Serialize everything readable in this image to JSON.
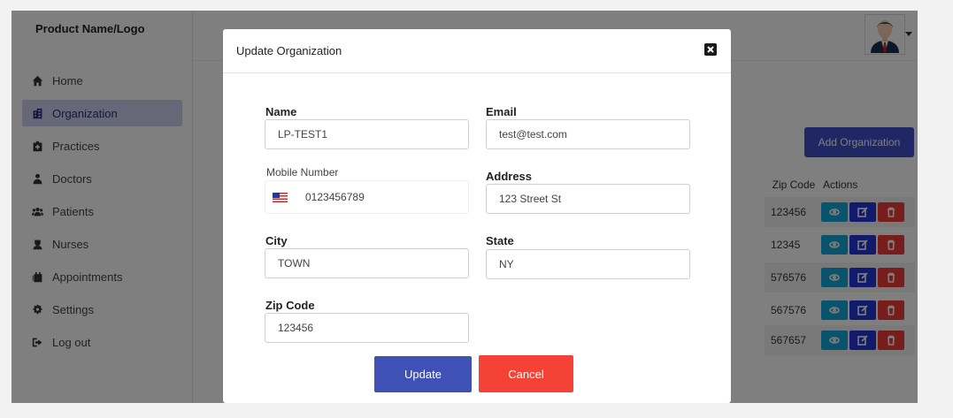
{
  "app": {
    "brand": "Product Name/Logo"
  },
  "sidebar": {
    "items": [
      {
        "label": "Home",
        "icon": "home-icon"
      },
      {
        "label": "Organization",
        "icon": "building-icon",
        "active": true
      },
      {
        "label": "Practices",
        "icon": "clinic-icon"
      },
      {
        "label": "Doctors",
        "icon": "doctor-icon"
      },
      {
        "label": "Patients",
        "icon": "patients-icon"
      },
      {
        "label": "Nurses",
        "icon": "nurse-icon"
      },
      {
        "label": "Appointments",
        "icon": "appointments-icon"
      },
      {
        "label": "Settings",
        "icon": "gear-icon"
      },
      {
        "label": "Log out",
        "icon": "logout-icon"
      }
    ]
  },
  "header": {
    "avatar": "user-avatar"
  },
  "main": {
    "add_button": "Add Organization",
    "table": {
      "columns": [
        "Zip Code",
        "Actions"
      ],
      "rows": [
        {
          "zip": "123456"
        },
        {
          "zip": "12345"
        },
        {
          "zip": "576576"
        },
        {
          "zip": "567576"
        },
        {
          "zip": "567657"
        }
      ]
    }
  },
  "modal": {
    "title": "Update Organization",
    "fields": {
      "name": {
        "label": "Name",
        "value": "LP-TEST1"
      },
      "email": {
        "label": "Email",
        "value": "test@test.com"
      },
      "mobile": {
        "label": "Mobile Number",
        "value": "0123456789",
        "flag": "us-flag-icon"
      },
      "address": {
        "label": "Address",
        "value": "123 Street St"
      },
      "city": {
        "label": "City",
        "value": "TOWN"
      },
      "state": {
        "label": "State",
        "value": "NY"
      },
      "zip": {
        "label": "Zip Code",
        "value": "123456"
      }
    },
    "update_label": "Update",
    "cancel_label": "Cancel"
  },
  "colors": {
    "primary": "#3f51b5",
    "danger": "#f44336",
    "view": "#12a9d8",
    "edit": "#2534d8"
  }
}
